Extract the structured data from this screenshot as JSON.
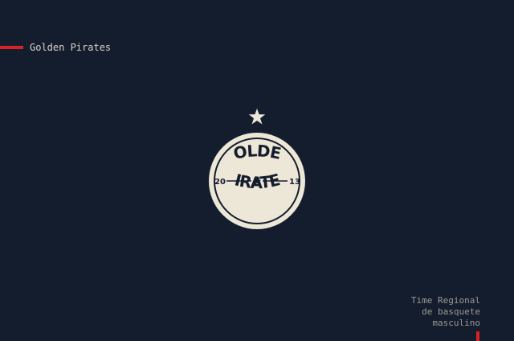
{
  "brand": {
    "name": "Golden Pirates"
  },
  "logo": {
    "line1": "GOLDEN",
    "line2": "PIRATES",
    "year_left": "20",
    "year_right": "13",
    "icon": "star-icon"
  },
  "tagline": {
    "line1": "Time Regional",
    "line2": "de basquete",
    "line3": "masculino"
  },
  "colors": {
    "background": "#141d2e",
    "accent": "#d92222",
    "badge": "#ede7d7",
    "text": "#d8d4c8",
    "muted_text": "#9a9a94"
  }
}
